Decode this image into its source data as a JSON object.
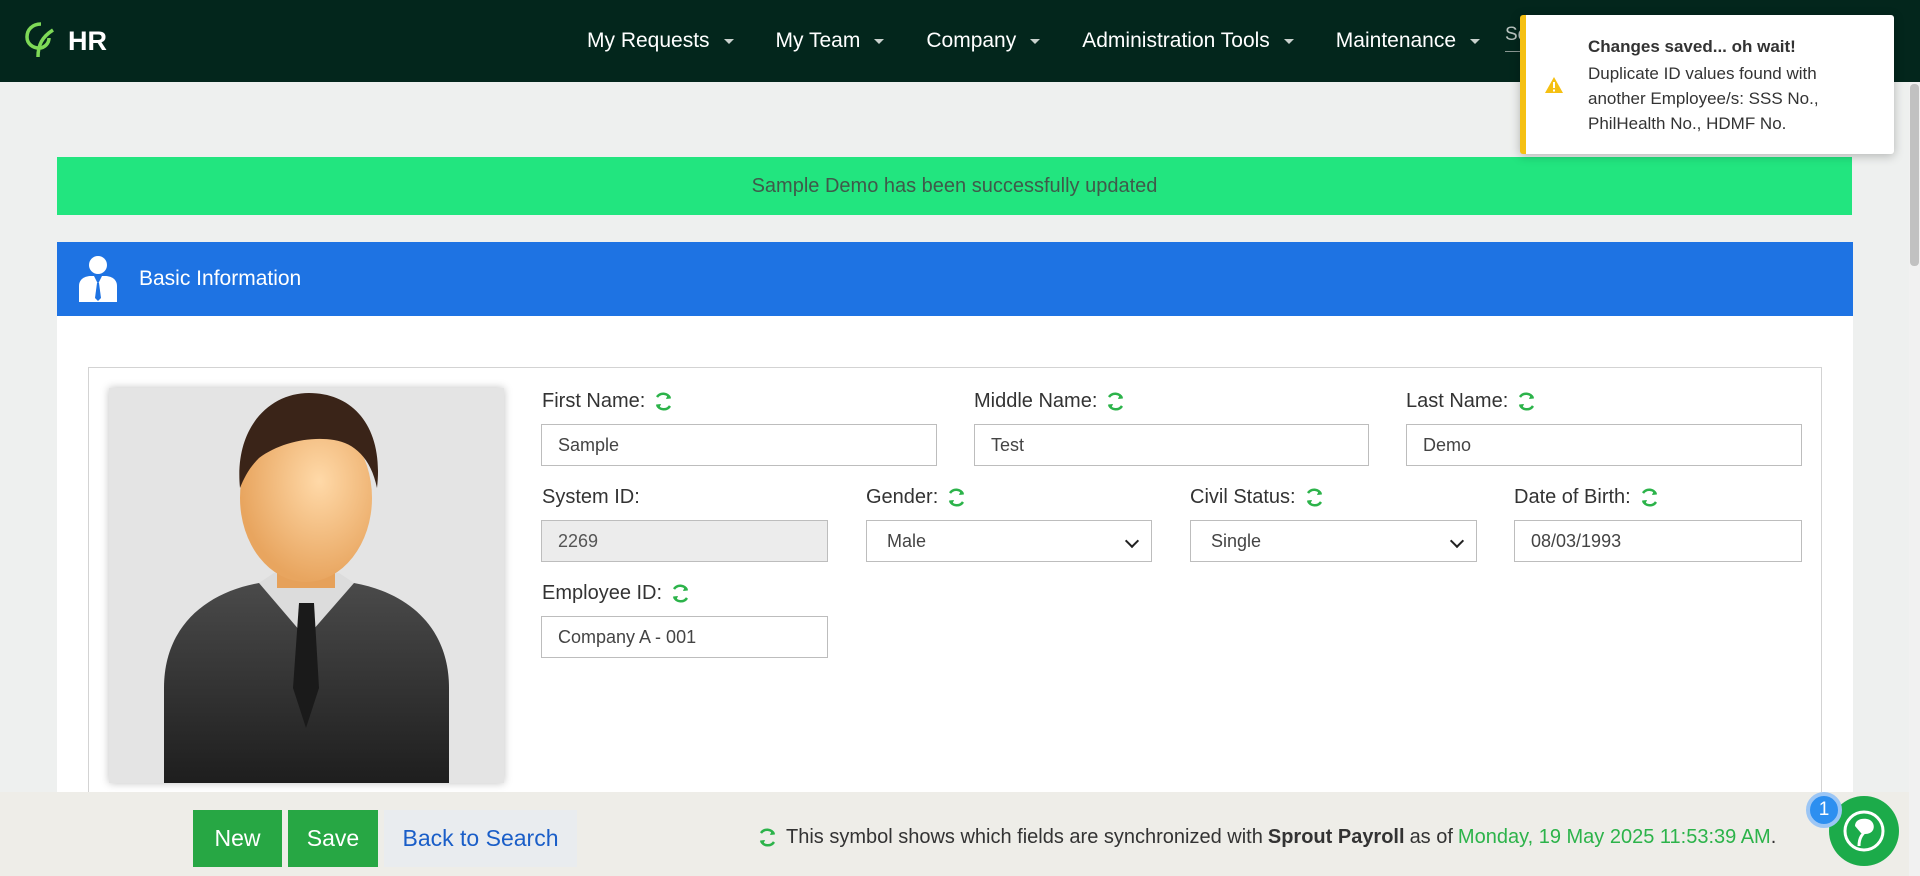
{
  "app": {
    "title": "HR"
  },
  "nav": {
    "items": [
      {
        "label": "My Requests"
      },
      {
        "label": "My Team"
      },
      {
        "label": "Company"
      },
      {
        "label": "Administration Tools"
      },
      {
        "label": "Maintenance"
      }
    ],
    "search_partial": "Se"
  },
  "toast": {
    "title": "Changes saved... oh wait!",
    "message": "Duplicate ID values found with another Employee/s: SSS No., PhilHealth No., HDMF No."
  },
  "alert": {
    "message": "Sample Demo has been successfully updated"
  },
  "panel": {
    "title": "Basic Information"
  },
  "form": {
    "first_name": {
      "label": "First Name:",
      "value": "Sample"
    },
    "middle_name": {
      "label": "Middle Name:",
      "value": "Test"
    },
    "last_name": {
      "label": "Last Name:",
      "value": "Demo"
    },
    "system_id": {
      "label": "System ID:",
      "value": "2269"
    },
    "gender": {
      "label": "Gender:",
      "value": "Male"
    },
    "civil_status": {
      "label": "Civil Status:",
      "value": "Single"
    },
    "date_of_birth": {
      "label": "Date of Birth:",
      "value": "08/03/1993"
    },
    "employee_id": {
      "label": "Employee ID:",
      "value": "Company A - 001"
    }
  },
  "footer": {
    "new_label": "New",
    "save_label": "Save",
    "back_label": "Back to Search",
    "note_prefix": "This symbol shows which fields are synchronized with",
    "note_product": "Sprout Payroll",
    "note_mid": "as of",
    "note_date": "Monday, 19 May 2025 11:53:39 AM",
    "note_suffix": "."
  },
  "chat": {
    "badge_count": "1"
  },
  "colors": {
    "nav_bg": "#03261c",
    "success": "#22e57f",
    "primary": "#1e73e3",
    "button_green": "#27a744",
    "warning": "#f5c012"
  }
}
